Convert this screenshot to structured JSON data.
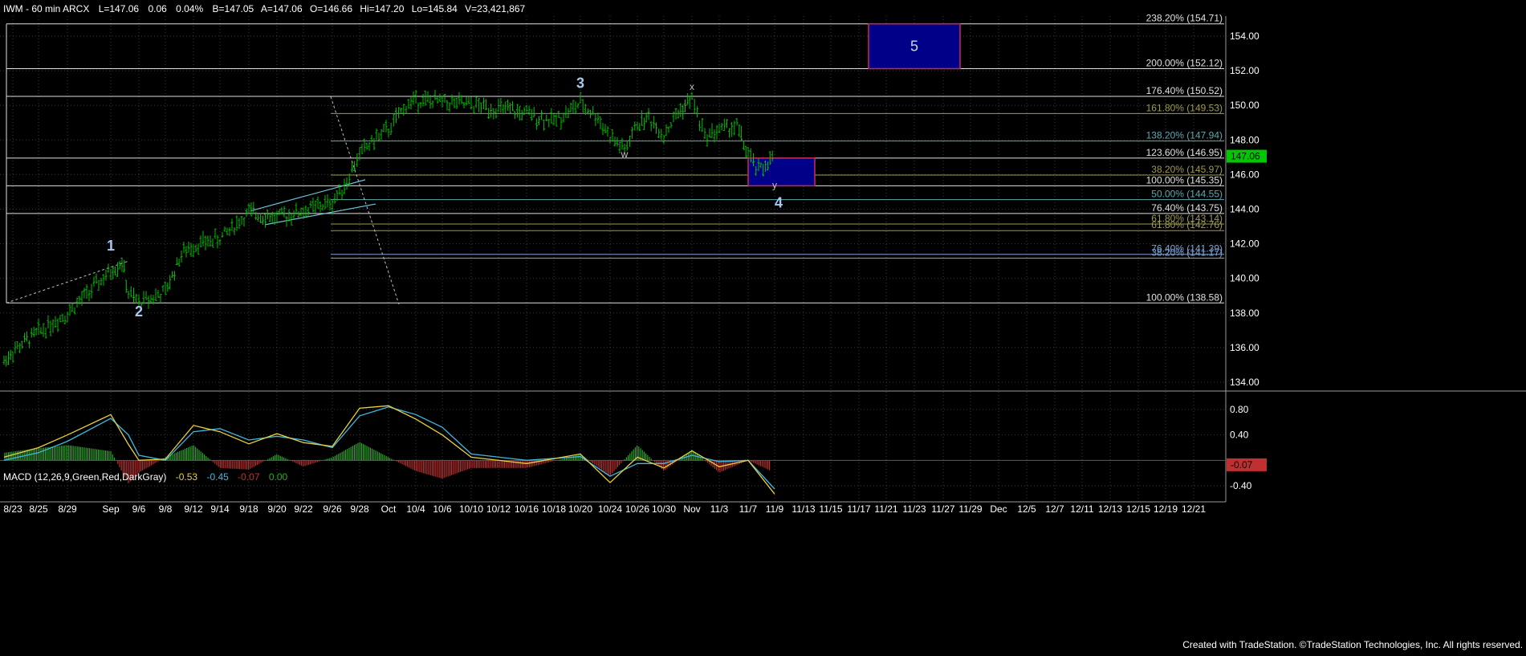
{
  "header": {
    "symbol": "IWM - 60 min  ARCX",
    "last": "L=147.06",
    "change": "0.06",
    "change_pct": "0.04%",
    "bid": "B=147.05",
    "ask": "A=147.06",
    "open": "146.66",
    "high": "Hi=147.20",
    "low": "Lo=145.84",
    "volume": "V=23,421,867"
  },
  "macd_header": {
    "title": "MACD (12,26,9,Green,Red,DarkGray)",
    "macd": "-0.53",
    "signal": "-0.45",
    "histogram": "-0.07",
    "zero": "0.00"
  },
  "credit": "Created with TradeStation. ©TradeStation Technologies, Inc. All rights reserved.",
  "colors": {
    "background": "#000000",
    "price_bars": "#00c000",
    "grid": "#3a3a3a",
    "fib_white": "#e0e0e0",
    "fib_teal": "#5fa8b0",
    "fib_olive": "#a09a4c",
    "fib_blue": "#7ea3d2",
    "box_fill": "#000088",
    "box_border": "#cc2a4a",
    "last_price_tag": "#00c800",
    "macd_line": "#e8d040",
    "signal_line": "#40b8e0",
    "hist_pos": "#2ea82e",
    "hist_neg": "#c03030"
  },
  "chart_data": [
    {
      "type": "line",
      "subtype": "ohlc-bar",
      "panel": "price",
      "series_name": "IWM",
      "x_labels": [
        "8/23",
        "8/25",
        "8/29",
        "Sep",
        "9/6",
        "9/8",
        "9/12",
        "9/14",
        "9/18",
        "9/20",
        "9/22",
        "9/26",
        "9/28",
        "Oct",
        "10/4",
        "10/6",
        "10/10",
        "10/12",
        "10/16",
        "10/18",
        "10/20",
        "10/24",
        "10/26",
        "10/30",
        "Nov",
        "11/3",
        "11/7",
        "11/9",
        "11/13",
        "11/15",
        "11/17",
        "11/21",
        "11/23",
        "11/27",
        "11/29",
        "Dec",
        "12/5",
        "12/7",
        "12/11",
        "12/13",
        "12/15",
        "12/19",
        "12/21"
      ],
      "y_ticks": [
        134.0,
        136.0,
        138.0,
        140.0,
        142.0,
        144.0,
        146.0,
        148.0,
        150.0,
        152.0,
        154.0
      ],
      "ylim": [
        132.0,
        155.3
      ],
      "last_price": "147.06",
      "path_points": [
        {
          "x": "8/22",
          "y": 135.2
        },
        {
          "x": "8/23",
          "y": 135.8
        },
        {
          "x": "8/25",
          "y": 136.9
        },
        {
          "x": "8/29",
          "y": 138.0
        },
        {
          "x": "Sep",
          "y": 140.4
        },
        {
          "x": "9/1",
          "y": 141.0
        },
        {
          "x": "9/5",
          "y": 139.1
        },
        {
          "x": "9/6",
          "y": 138.6
        },
        {
          "x": "9/8",
          "y": 139.2
        },
        {
          "x": "9/11",
          "y": 141.4
        },
        {
          "x": "9/12",
          "y": 141.9
        },
        {
          "x": "9/14",
          "y": 142.3
        },
        {
          "x": "9/18",
          "y": 143.8
        },
        {
          "x": "9/20",
          "y": 143.5
        },
        {
          "x": "9/22",
          "y": 143.9
        },
        {
          "x": "9/26",
          "y": 144.4
        },
        {
          "x": "9/27",
          "y": 145.6
        },
        {
          "x": "9/28",
          "y": 147.2
        },
        {
          "x": "9/29",
          "y": 148.0
        },
        {
          "x": "Oct",
          "y": 148.6
        },
        {
          "x": "10/3",
          "y": 150.0
        },
        {
          "x": "10/4",
          "y": 150.3
        },
        {
          "x": "10/6",
          "y": 150.2
        },
        {
          "x": "10/10",
          "y": 150.0
        },
        {
          "x": "10/12",
          "y": 149.8
        },
        {
          "x": "10/16",
          "y": 149.5
        },
        {
          "x": "10/18",
          "y": 149.1
        },
        {
          "x": "10/20",
          "y": 150.1
        },
        {
          "x": "10/23",
          "y": 149.3
        },
        {
          "x": "10/24",
          "y": 148.2
        },
        {
          "x": "10/25",
          "y": 147.4
        },
        {
          "x": "10/26",
          "y": 148.9
        },
        {
          "x": "10/27",
          "y": 149.3
        },
        {
          "x": "10/30",
          "y": 148.3
        },
        {
          "x": "10/31",
          "y": 149.6
        },
        {
          "x": "Nov",
          "y": 150.4
        },
        {
          "x": "11/2",
          "y": 148.2
        },
        {
          "x": "11/3",
          "y": 148.6
        },
        {
          "x": "11/6",
          "y": 148.8
        },
        {
          "x": "11/7",
          "y": 147.1
        },
        {
          "x": "11/8",
          "y": 146.2
        },
        {
          "x": "11/9",
          "y": 147.06
        }
      ],
      "fib_levels": [
        {
          "label": "238.20% (154.71)",
          "price": 154.71,
          "group": "white"
        },
        {
          "label": "200.00% (152.12)",
          "price": 152.12,
          "group": "white"
        },
        {
          "label": "176.40% (150.52)",
          "price": 150.52,
          "group": "white"
        },
        {
          "label": "161.80% (149.53)",
          "price": 149.53,
          "group": "olive"
        },
        {
          "label": "138.20% (147.94)",
          "price": 147.94,
          "group": "teal"
        },
        {
          "label": "123.60% (146.95)",
          "price": 146.95,
          "group": "white"
        },
        {
          "label": "38.20% (145.97)",
          "price": 145.97,
          "group": "olive"
        },
        {
          "label": "100.00% (145.35)",
          "price": 145.35,
          "group": "white"
        },
        {
          "label": "50.00% (144.55)",
          "price": 144.55,
          "group": "teal"
        },
        {
          "label": "76.40% (143.75)",
          "price": 143.75,
          "group": "white"
        },
        {
          "label": "61.80% (143.14)",
          "price": 143.14,
          "group": "olive"
        },
        {
          "label": "61.80% (142.76)",
          "price": 142.76,
          "group": "olive"
        },
        {
          "label": "76.40% (141.39)",
          "price": 141.39,
          "group": "blue"
        },
        {
          "label": "38.20% (141.17)",
          "price": 141.17,
          "group": "blue"
        },
        {
          "label": "100.00% (138.58)",
          "price": 138.58,
          "group": "white"
        }
      ],
      "target_boxes": [
        {
          "x_from": "11/20",
          "x_to": "11/27",
          "y_from": 152.12,
          "y_to": 154.71,
          "label": "5"
        },
        {
          "x_from": "11/7",
          "x_to": "11/12",
          "y_from": 145.35,
          "y_to": 146.95,
          "label": ""
        }
      ],
      "wave_labels": [
        {
          "text": "1",
          "x": "Sep",
          "y": 141.6,
          "size": "large"
        },
        {
          "text": "2",
          "x": "9/6",
          "y": 137.8,
          "size": "large"
        },
        {
          "text": "3",
          "x": "10/20",
          "y": 151.0,
          "size": "large"
        },
        {
          "text": "4",
          "x": "11/9",
          "y": 144.1,
          "size": "large"
        },
        {
          "text": "w",
          "x": "10/25",
          "y": 147.0,
          "size": "small"
        },
        {
          "text": "x",
          "x": "Nov",
          "y": 150.9,
          "size": "small"
        },
        {
          "text": "y",
          "x": "11/9",
          "y": 145.2,
          "size": "small"
        }
      ]
    },
    {
      "type": "line",
      "panel": "macd",
      "title": "MACD (12,26,9,Green,Red,DarkGray)",
      "y_ticks": [
        0.8,
        0.4,
        -0.4
      ],
      "ylim": [
        -0.6,
        1.0
      ],
      "last_value": "-0.07",
      "series": [
        {
          "name": "MACD",
          "points": [
            {
              "x": "8/22",
              "y": 0.05
            },
            {
              "x": "8/25",
              "y": 0.2
            },
            {
              "x": "8/29",
              "y": 0.4
            },
            {
              "x": "Sep",
              "y": 0.72
            },
            {
              "x": "9/5",
              "y": 0.25
            },
            {
              "x": "9/6",
              "y": 0.0
            },
            {
              "x": "9/8",
              "y": 0.02
            },
            {
              "x": "9/12",
              "y": 0.55
            },
            {
              "x": "9/14",
              "y": 0.45
            },
            {
              "x": "9/18",
              "y": 0.26
            },
            {
              "x": "9/20",
              "y": 0.42
            },
            {
              "x": "9/22",
              "y": 0.28
            },
            {
              "x": "9/26",
              "y": 0.22
            },
            {
              "x": "9/28",
              "y": 0.82
            },
            {
              "x": "Oct",
              "y": 0.86
            },
            {
              "x": "10/4",
              "y": 0.65
            },
            {
              "x": "10/6",
              "y": 0.4
            },
            {
              "x": "10/10",
              "y": 0.05
            },
            {
              "x": "10/16",
              "y": -0.05
            },
            {
              "x": "10/20",
              "y": 0.1
            },
            {
              "x": "10/24",
              "y": -0.35
            },
            {
              "x": "10/26",
              "y": 0.05
            },
            {
              "x": "10/30",
              "y": -0.12
            },
            {
              "x": "Nov",
              "y": 0.15
            },
            {
              "x": "11/3",
              "y": -0.1
            },
            {
              "x": "11/7",
              "y": 0.0
            },
            {
              "x": "11/9",
              "y": -0.53
            }
          ]
        },
        {
          "name": "Signal",
          "points": [
            {
              "x": "8/22",
              "y": 0.0
            },
            {
              "x": "8/25",
              "y": 0.12
            },
            {
              "x": "8/29",
              "y": 0.3
            },
            {
              "x": "Sep",
              "y": 0.66
            },
            {
              "x": "9/5",
              "y": 0.4
            },
            {
              "x": "9/6",
              "y": 0.08
            },
            {
              "x": "9/8",
              "y": 0.0
            },
            {
              "x": "9/12",
              "y": 0.45
            },
            {
              "x": "9/14",
              "y": 0.5
            },
            {
              "x": "9/18",
              "y": 0.32
            },
            {
              "x": "9/20",
              "y": 0.38
            },
            {
              "x": "9/22",
              "y": 0.32
            },
            {
              "x": "9/26",
              "y": 0.2
            },
            {
              "x": "9/28",
              "y": 0.7
            },
            {
              "x": "Oct",
              "y": 0.84
            },
            {
              "x": "10/4",
              "y": 0.72
            },
            {
              "x": "10/6",
              "y": 0.52
            },
            {
              "x": "10/10",
              "y": 0.1
            },
            {
              "x": "10/16",
              "y": 0.0
            },
            {
              "x": "10/20",
              "y": 0.06
            },
            {
              "x": "10/24",
              "y": -0.25
            },
            {
              "x": "10/26",
              "y": -0.05
            },
            {
              "x": "10/30",
              "y": -0.05
            },
            {
              "x": "Nov",
              "y": 0.08
            },
            {
              "x": "11/3",
              "y": -0.02
            },
            {
              "x": "11/7",
              "y": 0.0
            },
            {
              "x": "11/9",
              "y": -0.45
            }
          ]
        }
      ]
    }
  ]
}
